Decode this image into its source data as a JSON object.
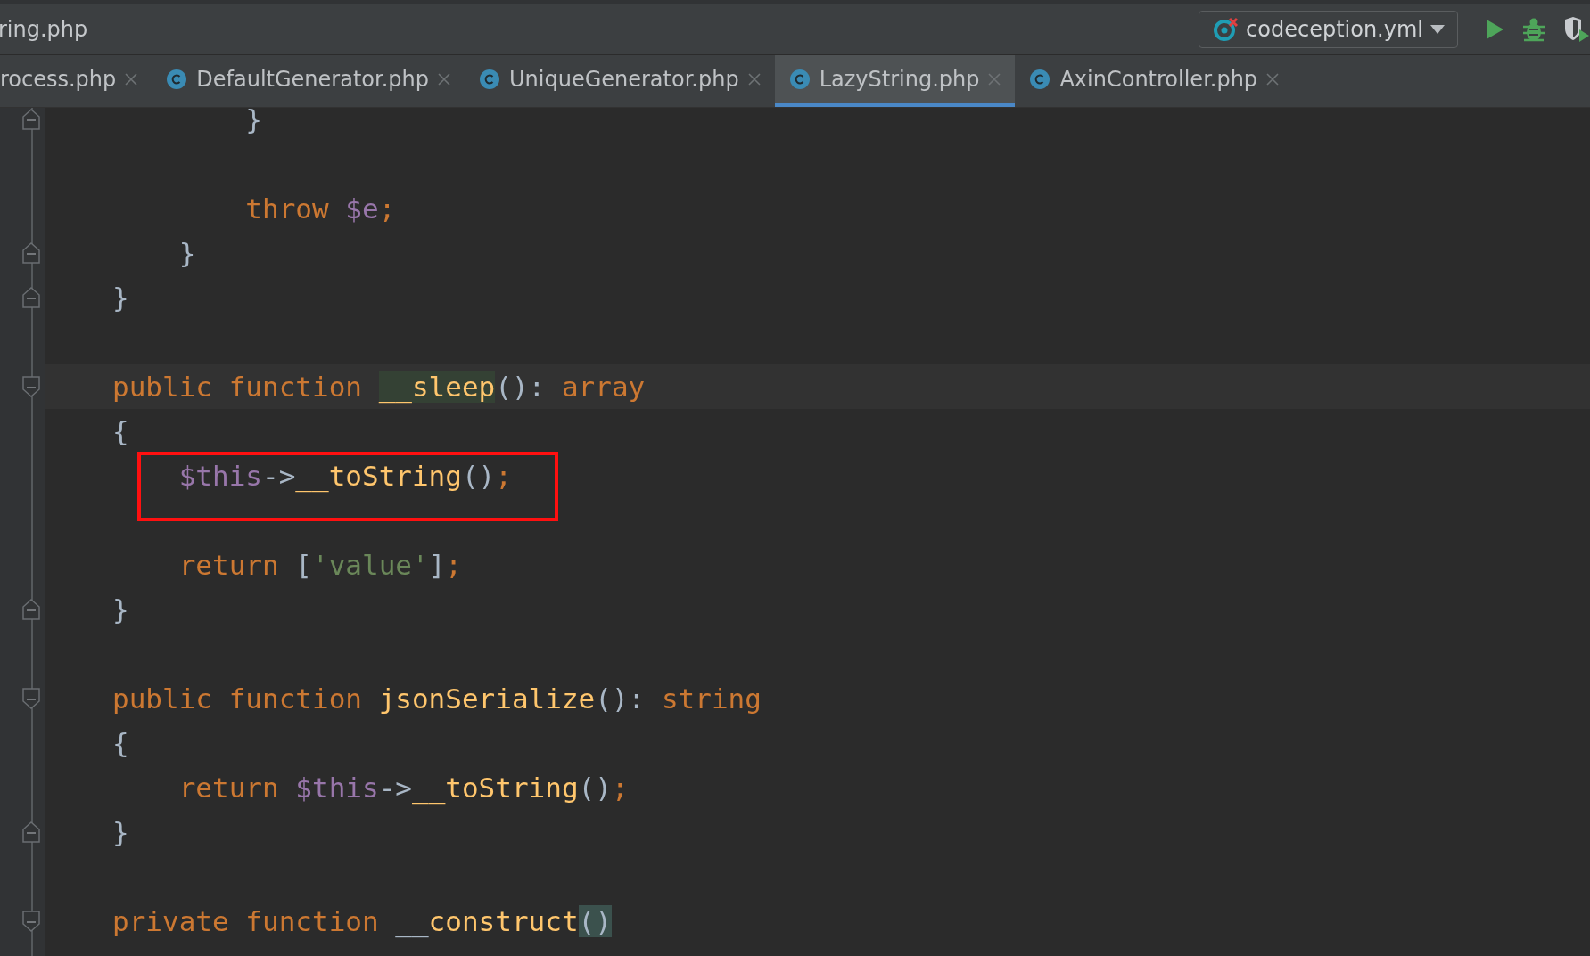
{
  "window": {
    "title": "ring.php"
  },
  "run_config": {
    "label": "codeception.yml"
  },
  "tabs": [
    {
      "label": "rocess.php",
      "selected": false,
      "icon": false
    },
    {
      "label": "DefaultGenerator.php",
      "selected": false,
      "icon": true
    },
    {
      "label": "UniqueGenerator.php",
      "selected": false,
      "icon": true
    },
    {
      "label": "LazyString.php",
      "selected": true,
      "icon": true
    },
    {
      "label": "AxinController.php",
      "selected": false,
      "icon": true
    }
  ],
  "blocks": [
    {
      "lines": [
        {
          "fold_close": true,
          "tokens": [
            {
              "kind": "plain",
              "text": "        }"
            }
          ]
        }
      ]
    },
    {
      "lines": [
        {
          "tokens": [
            {
              "kind": "keyword",
              "text": "        throw "
            },
            {
              "kind": "var",
              "text": "$e"
            },
            {
              "kind": "keyword",
              "text": ";"
            }
          ]
        },
        {
          "fold_close": true,
          "tokens": [
            {
              "kind": "plain",
              "text": "    }"
            }
          ]
        },
        {
          "fold_close": true,
          "tokens": [
            {
              "kind": "plain",
              "text": "}"
            }
          ]
        }
      ]
    },
    {
      "lines": [
        {
          "fold_open": true,
          "current": true,
          "tokens": [
            {
              "kind": "keyword",
              "text": "public function "
            },
            {
              "kind": "match",
              "text": "__sleep"
            },
            {
              "kind": "plain",
              "text": "(): "
            },
            {
              "kind": "keyword",
              "text": "array"
            }
          ]
        },
        {
          "tokens": [
            {
              "kind": "plain",
              "text": "{"
            }
          ]
        },
        {
          "boxed": true,
          "tokens": [
            {
              "kind": "var",
              "text": "    $this"
            },
            {
              "kind": "plain",
              "text": "->"
            },
            {
              "kind": "func",
              "text": "__toString"
            },
            {
              "kind": "plain",
              "text": "()"
            },
            {
              "kind": "keyword",
              "text": ";"
            }
          ]
        }
      ]
    },
    {
      "lines": [
        {
          "tokens": [
            {
              "kind": "keyword",
              "text": "    return "
            },
            {
              "kind": "plain",
              "text": "["
            },
            {
              "kind": "string",
              "text": "'value'"
            },
            {
              "kind": "plain",
              "text": "]"
            },
            {
              "kind": "keyword",
              "text": ";"
            }
          ]
        },
        {
          "fold_close": true,
          "tokens": [
            {
              "kind": "plain",
              "text": "}"
            }
          ]
        }
      ]
    },
    {
      "lines": [
        {
          "fold_open": true,
          "tokens": [
            {
              "kind": "keyword",
              "text": "public function "
            },
            {
              "kind": "func",
              "text": "jsonSerialize"
            },
            {
              "kind": "plain",
              "text": "(): "
            },
            {
              "kind": "keyword",
              "text": "string"
            }
          ]
        },
        {
          "tokens": [
            {
              "kind": "plain",
              "text": "{"
            }
          ]
        },
        {
          "tokens": [
            {
              "kind": "keyword",
              "text": "    return "
            },
            {
              "kind": "var",
              "text": "$this"
            },
            {
              "kind": "plain",
              "text": "->"
            },
            {
              "kind": "func",
              "text": "__toString"
            },
            {
              "kind": "plain",
              "text": "()"
            },
            {
              "kind": "keyword",
              "text": ";"
            }
          ]
        },
        {
          "fold_close": true,
          "tokens": [
            {
              "kind": "plain",
              "text": "}"
            }
          ]
        }
      ]
    },
    {
      "lines": [
        {
          "fold_open": true,
          "tokens": [
            {
              "kind": "keyword",
              "text": "private function "
            },
            {
              "kind": "plain",
              "text": "__"
            },
            {
              "kind": "func",
              "text": "construct"
            },
            {
              "kind": "paren",
              "text": "()"
            }
          ]
        }
      ]
    }
  ]
}
